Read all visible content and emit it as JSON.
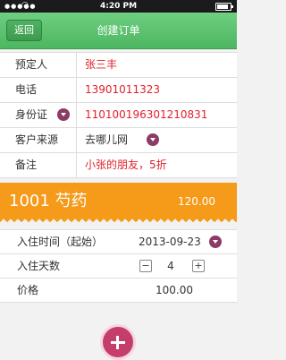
{
  "status": {
    "time": "4:20 PM",
    "battery_level": 0.85
  },
  "nav": {
    "back_label": "返回",
    "title": "创建订单"
  },
  "guest": {
    "rows": [
      {
        "label": "预定人",
        "value": "张三丰"
      },
      {
        "label": "电话",
        "value": "13901011323"
      },
      {
        "label": "身份证",
        "value": "110100196301210831"
      },
      {
        "label": "客户来源",
        "value": "去哪儿网"
      },
      {
        "label": "备注",
        "value": "小张的朋友，5折"
      }
    ]
  },
  "room": {
    "title": "1001  芍药",
    "price": "120.00"
  },
  "stay": {
    "start_label": "入住时间（起始）",
    "start_value": "2013-09-23",
    "days_label": "入住天数",
    "days_value": "4",
    "minus": "−",
    "plus": "+",
    "price_label": "价格",
    "price_value": "100.00"
  },
  "icons": {
    "dropdown": "chevron-down-icon",
    "add": "plus-icon"
  }
}
